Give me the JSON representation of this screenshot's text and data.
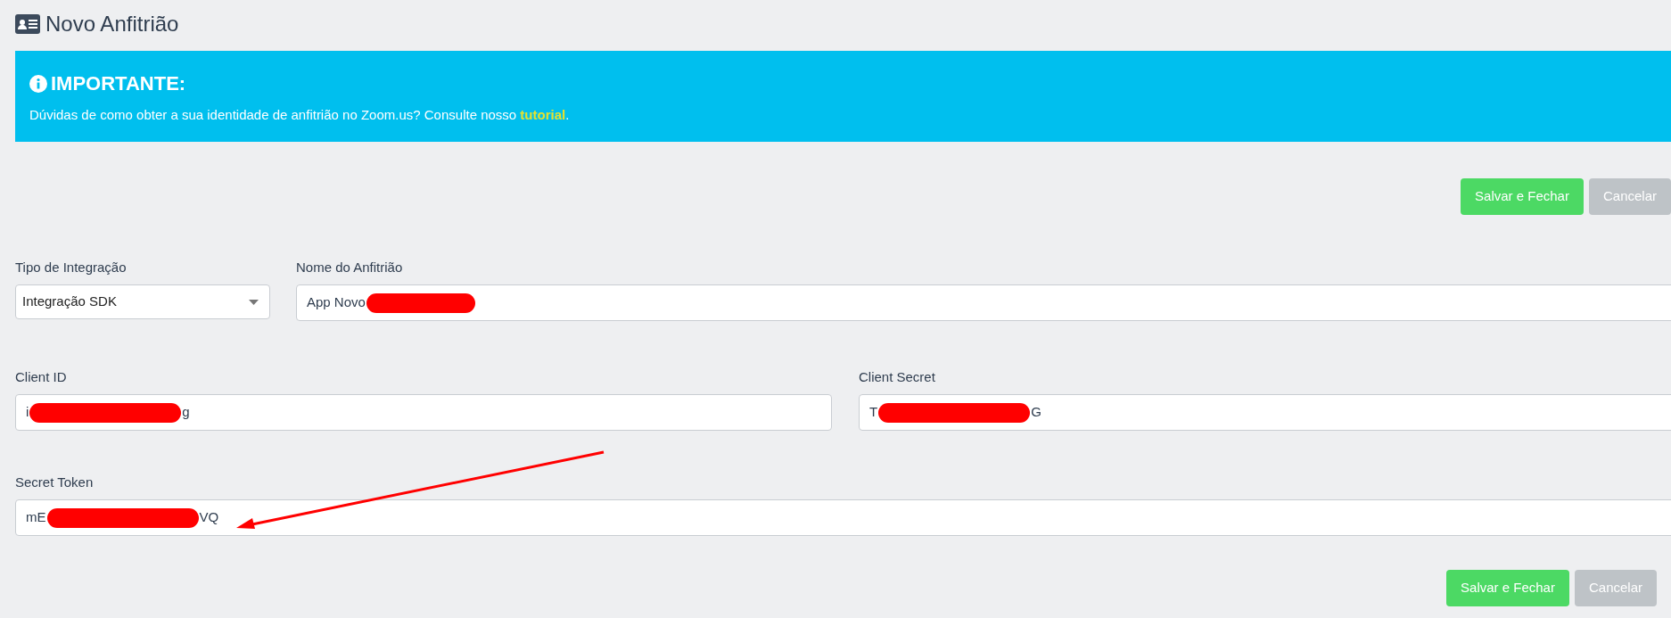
{
  "page_title": "Novo Anfitrião",
  "alert": {
    "heading": "IMPORTANTE:",
    "message": "Dúvidas de como obter a sua identidade de anfitrião no Zoom.us? Consulte nosso ",
    "link": "tutorial",
    "message_end": "."
  },
  "top_actions": [
    {
      "label": "Salvar e Fechar",
      "kind": "primary"
    },
    {
      "label": "Cancelar",
      "kind": "secondary"
    }
  ],
  "fields": [
    {
      "label": "Tipo de Integração",
      "kind": "select",
      "value": "Integração SDK"
    },
    {
      "label": "Nome do Anfitrião",
      "kind": "text",
      "visible_start": "App Novo",
      "redacted": true
    },
    {
      "label": "Client ID",
      "kind": "text",
      "visible_start": "i",
      "redacted": true,
      "visible_end": "g"
    },
    {
      "label": "Client Secret",
      "kind": "text",
      "visible_start": "T",
      "redacted": true,
      "visible_end": "G"
    },
    {
      "label": "Secret Token",
      "kind": "text",
      "visible_start": "mE",
      "redacted": true,
      "visible_end": "VQ"
    }
  ],
  "annotation": {
    "kind": "arrow"
  },
  "bottom_actions": [
    {
      "label": "Salvar e Fechar",
      "kind": "primary"
    },
    {
      "label": "Cancelar",
      "kind": "secondary"
    }
  ]
}
